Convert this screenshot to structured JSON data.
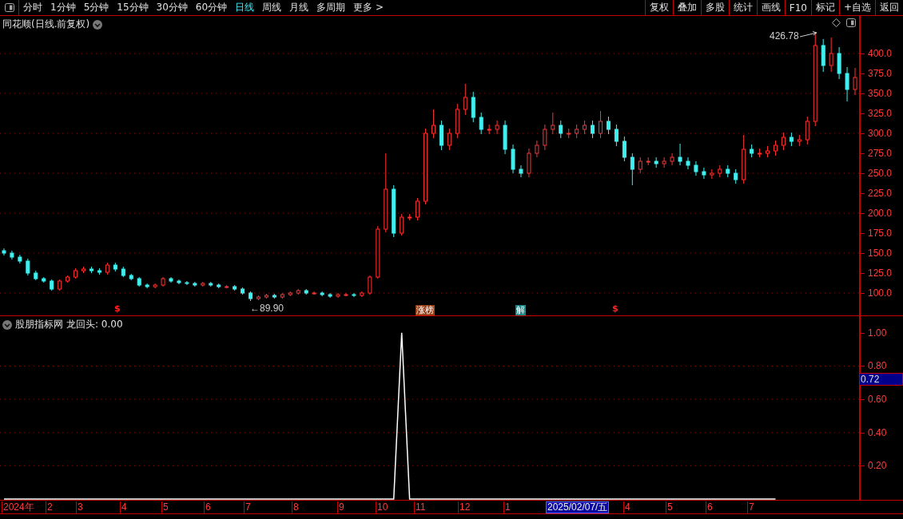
{
  "toolbar": {
    "periods": [
      {
        "label": "分时",
        "selected": false
      },
      {
        "label": "1分钟",
        "selected": false
      },
      {
        "label": "5分钟",
        "selected": false
      },
      {
        "label": "15分钟",
        "selected": false
      },
      {
        "label": "30分钟",
        "selected": false
      },
      {
        "label": "60分钟",
        "selected": false
      },
      {
        "label": "日线",
        "selected": true
      },
      {
        "label": "周线",
        "selected": false
      },
      {
        "label": "月线",
        "selected": false
      },
      {
        "label": "多周期",
        "selected": false
      },
      {
        "label": "更多 >",
        "selected": false
      }
    ],
    "actions": [
      "复权",
      "叠加",
      "多股",
      "统计",
      "画线",
      "F10",
      "标记",
      "+自选",
      "返回"
    ]
  },
  "price_panel": {
    "title": "同花顺(日线.前复权)",
    "high_label": "426.78",
    "low_label": "←89.90",
    "chart_data": {
      "type": "candlestick",
      "ylim": [
        71,
        447
      ],
      "grid": true,
      "yticks": [
        {
          "value": 100,
          "label": "100.0"
        },
        {
          "value": 125,
          "label": "125.0"
        },
        {
          "value": 150,
          "label": "150.0"
        },
        {
          "value": 175,
          "label": "175.0"
        },
        {
          "value": 200,
          "label": "200.0"
        },
        {
          "value": 225,
          "label": "225.0"
        },
        {
          "value": 250,
          "label": "250.0"
        },
        {
          "value": 275,
          "label": "275.0"
        },
        {
          "value": 300,
          "label": "300.0"
        },
        {
          "value": 325,
          "label": "325.0"
        },
        {
          "value": 350,
          "label": "350.0"
        },
        {
          "value": 375,
          "label": "375.0"
        },
        {
          "value": 400,
          "label": "400.0"
        }
      ],
      "ohlc": [
        [
          153,
          156,
          147,
          150
        ],
        [
          150,
          153,
          142,
          145
        ],
        [
          145,
          148,
          137,
          140
        ],
        [
          140,
          143,
          122,
          125
        ],
        [
          125,
          128,
          116,
          118
        ],
        [
          118,
          120,
          113,
          115
        ],
        [
          115,
          117,
          103,
          105
        ],
        [
          105,
          117,
          103,
          115
        ],
        [
          115,
          122,
          113,
          120
        ],
        [
          120,
          131,
          118,
          128
        ],
        [
          128,
          133,
          125,
          130
        ],
        [
          130,
          133,
          125,
          128
        ],
        [
          128,
          131,
          123,
          126
        ],
        [
          126,
          138,
          123,
          135
        ],
        [
          135,
          138,
          127,
          130
        ],
        [
          130,
          133,
          120,
          122
        ],
        [
          122,
          124,
          116,
          118
        ],
        [
          118,
          120,
          108,
          110
        ],
        [
          110,
          112,
          106,
          108
        ],
        [
          108,
          112,
          106,
          110
        ],
        [
          110,
          120,
          108,
          118
        ],
        [
          118,
          120,
          113,
          115
        ],
        [
          115,
          117,
          111,
          113
        ],
        [
          113,
          115,
          110,
          112
        ],
        [
          112,
          114,
          108,
          110
        ],
        [
          110,
          114,
          108,
          112
        ],
        [
          112,
          114,
          108,
          110
        ],
        [
          110,
          112,
          106,
          108
        ],
        [
          108,
          110,
          106,
          108
        ],
        [
          108,
          110,
          103,
          105
        ],
        [
          105,
          107,
          98,
          100
        ],
        [
          100,
          102,
          90,
          93
        ],
        [
          93,
          97,
          91,
          95
        ],
        [
          95,
          99,
          93,
          97
        ],
        [
          97,
          99,
          93,
          95
        ],
        [
          95,
          100,
          93,
          98
        ],
        [
          98,
          102,
          96,
          100
        ],
        [
          100,
          105,
          98,
          103
        ],
        [
          103,
          105,
          98,
          100
        ],
        [
          100,
          102,
          98,
          100
        ],
        [
          100,
          102,
          96,
          98
        ],
        [
          98,
          100,
          94,
          96
        ],
        [
          96,
          100,
          94,
          98
        ],
        [
          98,
          100,
          96,
          98
        ],
        [
          98,
          100,
          95,
          97
        ],
        [
          97,
          102,
          95,
          100
        ],
        [
          100,
          122,
          98,
          120
        ],
        [
          120,
          184,
          118,
          180
        ],
        [
          180,
          275,
          176,
          230
        ],
        [
          230,
          235,
          170,
          175
        ],
        [
          175,
          199,
          172,
          195
        ],
        [
          195,
          199,
          191,
          195
        ],
        [
          195,
          219,
          191,
          215
        ],
        [
          215,
          306,
          211,
          300
        ],
        [
          300,
          330,
          294,
          310
        ],
        [
          310,
          316,
          279,
          285
        ],
        [
          285,
          306,
          279,
          300
        ],
        [
          300,
          337,
          294,
          330
        ],
        [
          330,
          362,
          323,
          345
        ],
        [
          345,
          352,
          314,
          320
        ],
        [
          320,
          326,
          299,
          305
        ],
        [
          305,
          311,
          299,
          305
        ],
        [
          305,
          316,
          299,
          310
        ],
        [
          310,
          316,
          274,
          280
        ],
        [
          280,
          286,
          250,
          255
        ],
        [
          255,
          260,
          245,
          250
        ],
        [
          250,
          281,
          245,
          275
        ],
        [
          275,
          291,
          270,
          285
        ],
        [
          285,
          311,
          279,
          305
        ],
        [
          305,
          326,
          299,
          310
        ],
        [
          310,
          316,
          294,
          300
        ],
        [
          300,
          306,
          294,
          300
        ],
        [
          300,
          311,
          294,
          305
        ],
        [
          305,
          316,
          299,
          310
        ],
        [
          310,
          316,
          294,
          300
        ],
        [
          300,
          328,
          294,
          315
        ],
        [
          315,
          321,
          299,
          305
        ],
        [
          305,
          311,
          284,
          290
        ],
        [
          290,
          296,
          265,
          270
        ],
        [
          270,
          275,
          235,
          255
        ],
        [
          255,
          270,
          250,
          265
        ],
        [
          265,
          270,
          260,
          265
        ],
        [
          265,
          270,
          257,
          262
        ],
        [
          262,
          270,
          257,
          265
        ],
        [
          265,
          275,
          260,
          270
        ],
        [
          270,
          287,
          260,
          265
        ],
        [
          265,
          270,
          255,
          260
        ],
        [
          260,
          265,
          247,
          252
        ],
        [
          252,
          257,
          243,
          248
        ],
        [
          248,
          255,
          243,
          250
        ],
        [
          250,
          260,
          245,
          255
        ],
        [
          255,
          260,
          245,
          250
        ],
        [
          250,
          255,
          237,
          242
        ],
        [
          242,
          298,
          237,
          280
        ],
        [
          280,
          286,
          270,
          275
        ],
        [
          275,
          281,
          270,
          275
        ],
        [
          275,
          284,
          270,
          278
        ],
        [
          278,
          291,
          272,
          285
        ],
        [
          285,
          301,
          279,
          295
        ],
        [
          295,
          301,
          284,
          290
        ],
        [
          290,
          298,
          284,
          292
        ],
        [
          292,
          321,
          286,
          315
        ],
        [
          315,
          427,
          309,
          410
        ],
        [
          410,
          418,
          377,
          385
        ],
        [
          385,
          420,
          377,
          400
        ],
        [
          400,
          408,
          368,
          375
        ],
        [
          375,
          383,
          340,
          355
        ],
        [
          355,
          382,
          348,
          370
        ]
      ]
    }
  },
  "event_markers": [
    {
      "kind": "dollar",
      "text": "$"
    },
    {
      "kind": "tag",
      "text": "涨榜",
      "color": "#a04018"
    },
    {
      "kind": "tag",
      "text": "解",
      "color": "#168888"
    },
    {
      "kind": "dollar",
      "text": "$"
    }
  ],
  "indicator_panel": {
    "source": "股朋指标网",
    "reading": "龙回头: 0.00",
    "cursor_value": "0.72",
    "chart_data": {
      "type": "line",
      "grid": true,
      "ylim": [
        0,
        1.1
      ],
      "yticks": [
        {
          "value": 0.2,
          "label": "0.20"
        },
        {
          "value": 0.4,
          "label": "0.40"
        },
        {
          "value": 0.6,
          "label": "0.60"
        },
        {
          "value": 0.8,
          "label": "0.80"
        },
        {
          "value": 1.0,
          "label": "1.00"
        }
      ],
      "series": [
        {
          "color": "#ffffff",
          "values": [
            0,
            0,
            0,
            0,
            0,
            0,
            0,
            0,
            0,
            0,
            0,
            0,
            0,
            0,
            0,
            0,
            0,
            0,
            0,
            0,
            0,
            0,
            0,
            0,
            0,
            0,
            0,
            0,
            0,
            0,
            0,
            0,
            0,
            0,
            0,
            0,
            0,
            0,
            0,
            0,
            0,
            0,
            0,
            0,
            0,
            0,
            0,
            0,
            0,
            0,
            1,
            0,
            0,
            0,
            0,
            0,
            0,
            0,
            0,
            0,
            0,
            0,
            0,
            0,
            0,
            0,
            0,
            0,
            0,
            0,
            0,
            0,
            0,
            0,
            0,
            0,
            0,
            0,
            0,
            0,
            0,
            0,
            0,
            0,
            0,
            0,
            0,
            0,
            0,
            0,
            0,
            0,
            0,
            0,
            0,
            0,
            0,
            0,
            null,
            null,
            null,
            null,
            null,
            null,
            null,
            null,
            null,
            null
          ]
        }
      ]
    }
  },
  "date_axis": {
    "labels": [
      "2024年",
      "2",
      "3",
      "4",
      "5",
      "6",
      "7",
      "8",
      "9",
      "10",
      "11",
      "12",
      "1",
      "4",
      "5",
      "6",
      "7"
    ],
    "cursor_date": "2025/02/07/五"
  }
}
